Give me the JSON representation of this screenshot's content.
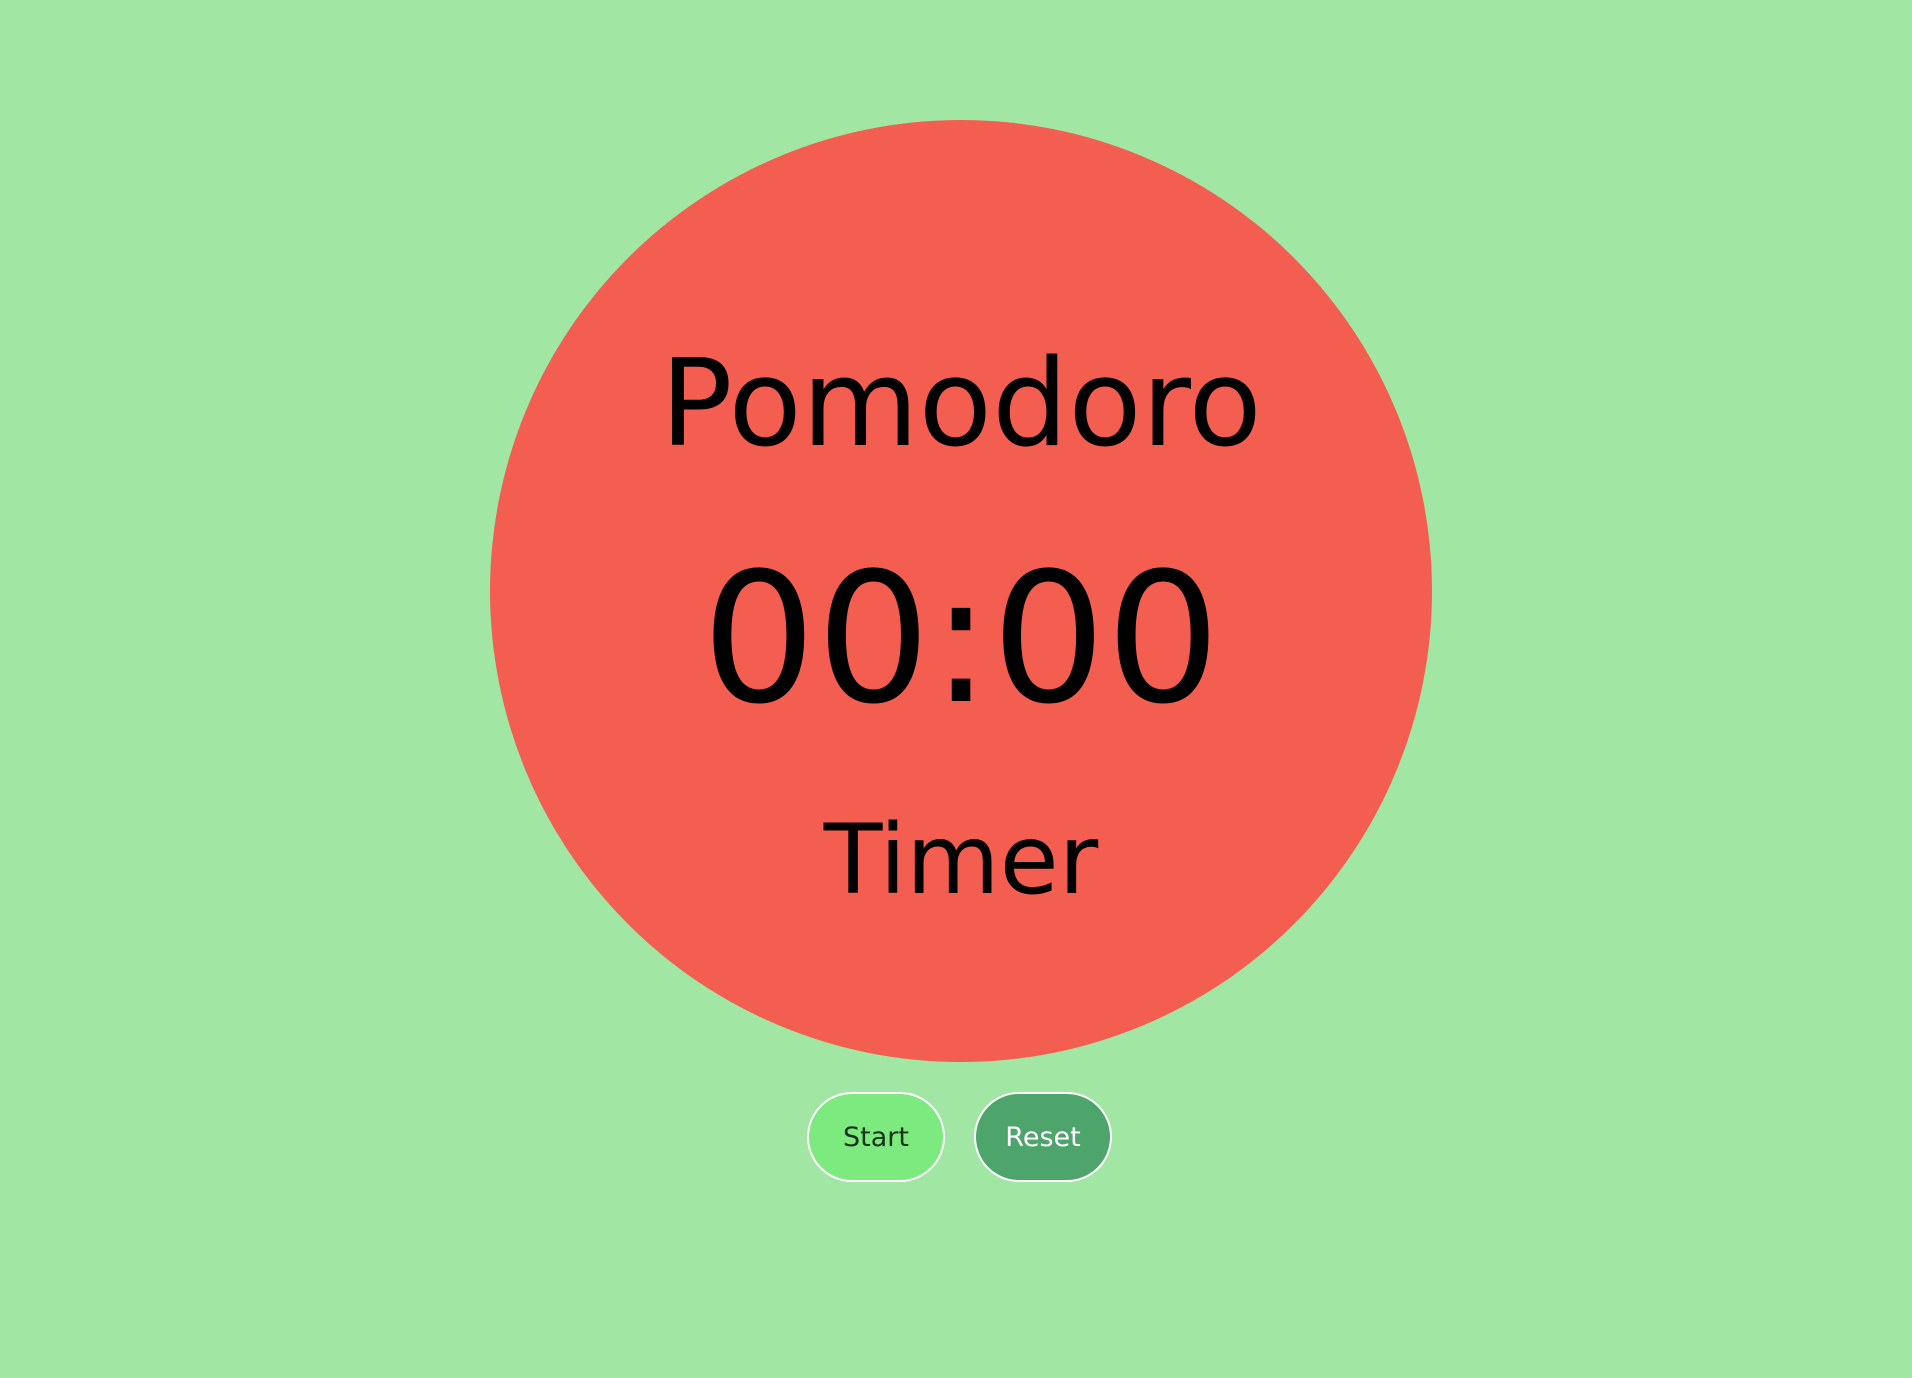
{
  "timer": {
    "title": "Pomodoro",
    "time": "00:00",
    "subtitle": "Timer"
  },
  "controls": {
    "start_label": "Start",
    "reset_label": "Reset"
  },
  "colors": {
    "background": "#a1e6a2",
    "circle": "#f45e50",
    "start_button": "#7dea7f",
    "reset_button": "#4ea56c"
  }
}
